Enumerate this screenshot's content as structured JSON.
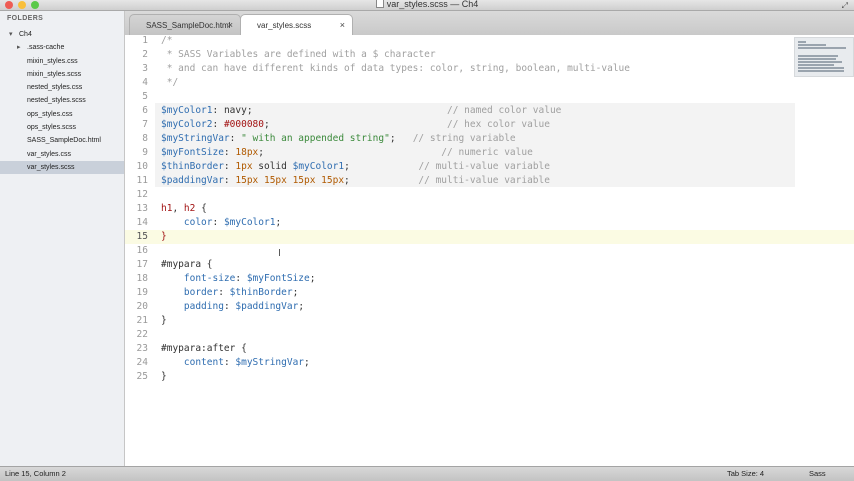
{
  "window": {
    "title": "var_styles.scss — Ch4",
    "traffic_colors": [
      "#ee5c54",
      "#f9bf3b",
      "#5bc94a"
    ]
  },
  "sidebar": {
    "header": "FOLDERS",
    "root_folder": "Ch4",
    "items": [
      {
        "label": ".sass-cache",
        "type": "folder"
      },
      {
        "label": "mixin_styles.css",
        "type": "file"
      },
      {
        "label": "mixin_styles.scss",
        "type": "file"
      },
      {
        "label": "nested_styles.css",
        "type": "file"
      },
      {
        "label": "nested_styles.scss",
        "type": "file"
      },
      {
        "label": "ops_styles.css",
        "type": "file"
      },
      {
        "label": "ops_styles.scss",
        "type": "file"
      },
      {
        "label": "SASS_SampleDoc.html",
        "type": "file"
      },
      {
        "label": "var_styles.css",
        "type": "file"
      },
      {
        "label": "var_styles.scss",
        "type": "file",
        "selected": true
      }
    ]
  },
  "tabs": [
    {
      "label": "SASS_SampleDoc.html",
      "active": false
    },
    {
      "label": "var_styles.scss",
      "active": true
    }
  ],
  "editor": {
    "current_line": 15,
    "lines": [
      {
        "n": "1",
        "tokens": [
          [
            "c",
            "/*"
          ]
        ]
      },
      {
        "n": "2",
        "tokens": [
          [
            "c",
            " * SASS Variables are defined with a $ character"
          ]
        ]
      },
      {
        "n": "3",
        "tokens": [
          [
            "c",
            " * and can have different kinds of data types: color, string, boolean, multi-value"
          ]
        ]
      },
      {
        "n": "4",
        "tokens": [
          [
            "c",
            " */"
          ]
        ]
      },
      {
        "n": "5",
        "tokens": []
      },
      {
        "n": "6",
        "tokens": [
          [
            "v",
            "$myColor1"
          ],
          [
            "p",
            ": "
          ],
          [
            "p",
            "navy"
          ],
          [
            "p",
            ";                                  "
          ],
          [
            "c",
            "// named color value"
          ]
        ]
      },
      {
        "n": "7",
        "tokens": [
          [
            "v",
            "$myColor2"
          ],
          [
            "p",
            ": "
          ],
          [
            "s",
            "#000080"
          ],
          [
            "p",
            ";                               "
          ],
          [
            "c",
            "// hex color value"
          ]
        ]
      },
      {
        "n": "8",
        "tokens": [
          [
            "v",
            "$myStringVar"
          ],
          [
            "p",
            ": "
          ],
          [
            "g",
            "\" with an appended string\""
          ],
          [
            "p",
            ";   "
          ],
          [
            "c",
            "// string variable"
          ]
        ]
      },
      {
        "n": "9",
        "tokens": [
          [
            "v",
            "$myFontSize"
          ],
          [
            "p",
            ": "
          ],
          [
            "o",
            "18px"
          ],
          [
            "p",
            ";                               "
          ],
          [
            "c",
            "// numeric value"
          ]
        ]
      },
      {
        "n": "10",
        "tokens": [
          [
            "v",
            "$thinBorder"
          ],
          [
            "p",
            ": "
          ],
          [
            "o",
            "1px"
          ],
          [
            "p",
            " solid "
          ],
          [
            "v",
            "$myColor1"
          ],
          [
            "p",
            ";            "
          ],
          [
            "c",
            "// multi-value variable"
          ]
        ]
      },
      {
        "n": "11",
        "tokens": [
          [
            "v",
            "$paddingVar"
          ],
          [
            "p",
            ": "
          ],
          [
            "o",
            "15px 15px 15px 15px"
          ],
          [
            "p",
            ";            "
          ],
          [
            "c",
            "// multi-value variable"
          ]
        ]
      },
      {
        "n": "12",
        "tokens": []
      },
      {
        "n": "13",
        "tokens": [
          [
            "s",
            "h1"
          ],
          [
            "p",
            ", "
          ],
          [
            "s",
            "h2"
          ],
          [
            "p",
            " {"
          ]
        ]
      },
      {
        "n": "14",
        "tokens": [
          [
            "p",
            "    "
          ],
          [
            "v",
            "color"
          ],
          [
            "p",
            ": "
          ],
          [
            "v",
            "$myColor1"
          ],
          [
            "p",
            ";"
          ]
        ]
      },
      {
        "n": "15",
        "tokens": [
          [
            "s",
            "}"
          ]
        ]
      },
      {
        "n": "16",
        "tokens": []
      },
      {
        "n": "17",
        "tokens": [
          [
            "p",
            "#mypara {"
          ]
        ]
      },
      {
        "n": "18",
        "tokens": [
          [
            "p",
            "    "
          ],
          [
            "v",
            "font-size"
          ],
          [
            "p",
            ": "
          ],
          [
            "v",
            "$myFontSize"
          ],
          [
            "p",
            ";"
          ]
        ]
      },
      {
        "n": "19",
        "tokens": [
          [
            "p",
            "    "
          ],
          [
            "v",
            "border"
          ],
          [
            "p",
            ": "
          ],
          [
            "v",
            "$thinBorder"
          ],
          [
            "p",
            ";"
          ]
        ]
      },
      {
        "n": "20",
        "tokens": [
          [
            "p",
            "    "
          ],
          [
            "v",
            "padding"
          ],
          [
            "p",
            ": "
          ],
          [
            "v",
            "$paddingVar"
          ],
          [
            "p",
            ";"
          ]
        ]
      },
      {
        "n": "21",
        "tokens": [
          [
            "p",
            "}"
          ]
        ]
      },
      {
        "n": "22",
        "tokens": []
      },
      {
        "n": "23",
        "tokens": [
          [
            "p",
            "#mypara:after {"
          ]
        ]
      },
      {
        "n": "24",
        "tokens": [
          [
            "p",
            "    "
          ],
          [
            "v",
            "content"
          ],
          [
            "p",
            ": "
          ],
          [
            "v",
            "$myStringVar"
          ],
          [
            "p",
            ";"
          ]
        ]
      },
      {
        "n": "25",
        "tokens": [
          [
            "p",
            "}"
          ]
        ]
      }
    ]
  },
  "statusbar": {
    "position": "Line 15, Column 2",
    "tab_size": "Tab Size: 4",
    "syntax": "Sass"
  }
}
